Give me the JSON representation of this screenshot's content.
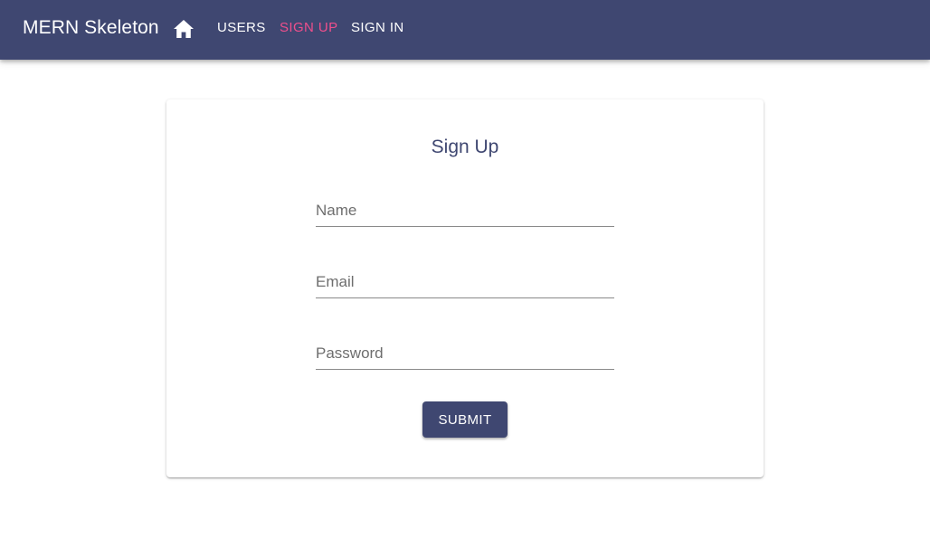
{
  "appbar": {
    "brand": "MERN Skeleton",
    "home_icon": "home-icon",
    "nav": {
      "users": "USERS",
      "signup": "SIGN UP",
      "signin": "SIGN IN"
    },
    "background_color": "#3f4771",
    "active_link_color": "#ef4f8c"
  },
  "signup_card": {
    "title": "Sign Up",
    "fields": {
      "name": {
        "placeholder": "Name",
        "value": ""
      },
      "email": {
        "placeholder": "Email",
        "value": ""
      },
      "password": {
        "placeholder": "Password",
        "value": ""
      }
    },
    "submit_label": "SUBMIT"
  }
}
